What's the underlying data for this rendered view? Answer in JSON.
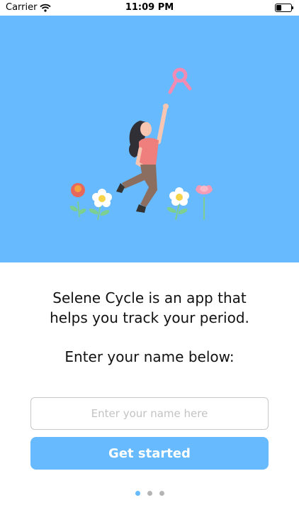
{
  "status_bar": {
    "carrier": "Carrier",
    "time": "11:09 PM",
    "battery_level": 0.35
  },
  "hero": {
    "background_color": "#66bafd",
    "illustration": "woman-reaching-for-pink-ribbon-icon"
  },
  "intro": {
    "line1": "Selene Cycle is an app that",
    "line2": "helps you track your period."
  },
  "prompt": "Enter your name below:",
  "name_field": {
    "value": "",
    "placeholder": "Enter your name here"
  },
  "cta": {
    "label": "Get started",
    "color": "#66bafd"
  },
  "pager": {
    "count": 3,
    "active_index": 0
  }
}
